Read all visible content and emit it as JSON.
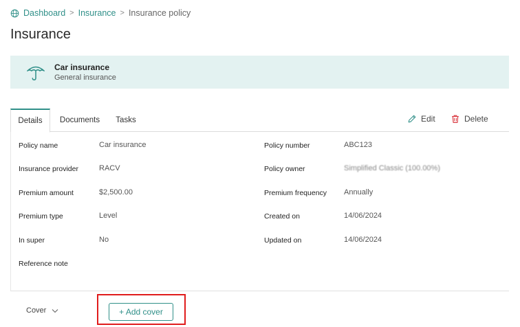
{
  "breadcrumb": {
    "items": [
      "Dashboard",
      "Insurance",
      "Insurance policy"
    ],
    "separator": ">"
  },
  "page": {
    "title": "Insurance"
  },
  "banner": {
    "title": "Car insurance",
    "subtitle": "General insurance"
  },
  "tabs": [
    {
      "label": "Details",
      "active": true
    },
    {
      "label": "Documents",
      "active": false
    },
    {
      "label": "Tasks",
      "active": false
    }
  ],
  "actions": {
    "edit_label": "Edit",
    "delete_label": "Delete"
  },
  "details": {
    "left": [
      {
        "label": "Policy name",
        "value": "Car insurance"
      },
      {
        "label": "Insurance provider",
        "value": "RACV"
      },
      {
        "label": "Premium amount",
        "value": "$2,500.00"
      },
      {
        "label": "Premium type",
        "value": "Level"
      },
      {
        "label": "In super",
        "value": "No"
      },
      {
        "label": "Reference note",
        "value": ""
      }
    ],
    "right": [
      {
        "label": "Policy number",
        "value": "ABC123"
      },
      {
        "label": "Policy owner",
        "value": "Simplified Classic (100.00%)"
      },
      {
        "label": "Premium frequency",
        "value": "Annually"
      },
      {
        "label": "Created on",
        "value": "14/06/2024"
      },
      {
        "label": "Updated on",
        "value": "14/06/2024"
      }
    ]
  },
  "cover": {
    "label": "Cover",
    "add_label": "+ Add cover"
  },
  "colors": {
    "accent": "#2f8f88",
    "banner_bg": "#e3f2f1",
    "highlight": "#e01b1b",
    "delete": "#d9363e"
  }
}
